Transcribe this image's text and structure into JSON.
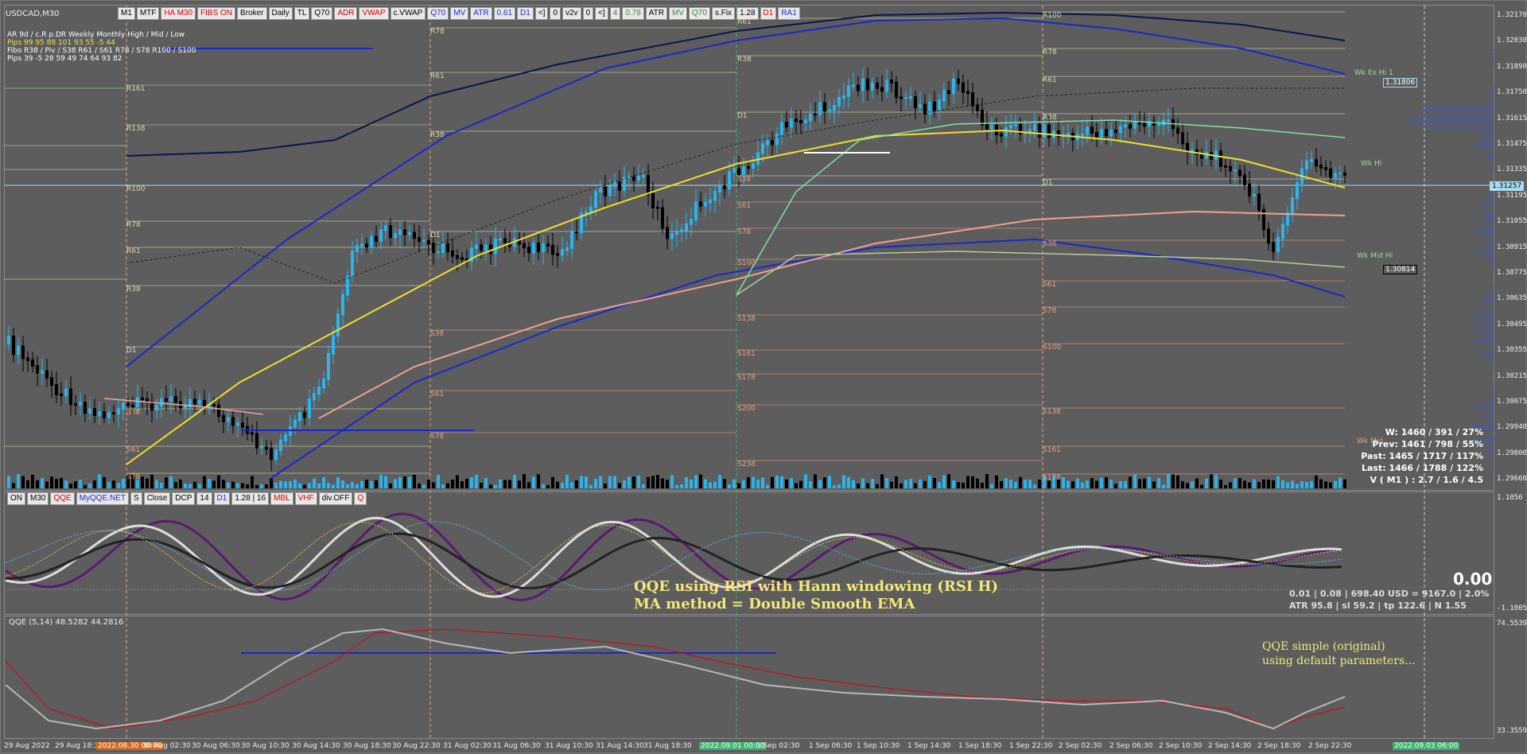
{
  "symbol": "USDCAD,M30",
  "toolbar": [
    "M1",
    "MTF",
    "HA M30",
    "FIBS ON",
    "Broker",
    "Daily",
    "TL",
    "Q70",
    "ADR",
    "VWAP",
    "c.VWAP",
    "Q70",
    "MV",
    "ATR",
    "0.61",
    "D1",
    "<]",
    "0",
    "v2v",
    "0",
    "<]",
    "4",
    "0.78",
    "ATR",
    "MV",
    "Q70",
    "s.Fix",
    "1.28",
    "D1",
    "RA1"
  ],
  "stats": {
    "row1": [
      "AR",
      "9d / c.R",
      "p.DR",
      "Weekly",
      "Monthly",
      "High / Mid / Low"
    ],
    "row2": [
      "Pips",
      "99",
      "95",
      "88",
      "101",
      "93",
      "55",
      "-5",
      "44"
    ],
    "row3": [
      "Fibo",
      "R38 / Piv / S38",
      "R61 / S61",
      "R78 / S78",
      "R100 / S100"
    ],
    "row4": [
      "Pips",
      "39",
      "-5",
      "28",
      "59",
      "49",
      "74",
      "64",
      "93",
      "82"
    ]
  },
  "price_scale": [
    "1.32170",
    "1.32030",
    "1.31890",
    "1.31750",
    "1.31615",
    "1.31475",
    "1.31335",
    "1.31195",
    "1.31055",
    "1.30915",
    "1.30775",
    "1.30635",
    "1.30495",
    "1.30355",
    "1.30215",
    "1.30075",
    "1.29940",
    "1.29800",
    "1.29660"
  ],
  "price_boxes": {
    "current": "1.31257",
    "wk_ex_hi": "1.31806",
    "wk_mid_hi": "1.30814"
  },
  "right_labels": {
    "wk_ex_hi": "Wk Ex Hi 1",
    "wk_hi": "Wk Hi",
    "wk_mid_hi": "Wk Mid Hi",
    "wk_mid": "Wk Mid"
  },
  "level_labels": {
    "day1": [
      "R161",
      "R138",
      "R100",
      "R78",
      "R61",
      "R38",
      "D1",
      "S38",
      "S61",
      "S78"
    ],
    "day2": [
      "R78",
      "R61",
      "R38",
      "D1",
      "S38",
      "S61",
      "S78"
    ],
    "day3": [
      "R61",
      "R38",
      "D1",
      "S38",
      "S61",
      "S78",
      "S100",
      "S138",
      "S161",
      "S178",
      "S200",
      "S238"
    ],
    "day4": [
      "R100",
      "R78",
      "R61",
      "R38",
      "D1",
      "S38",
      "S61",
      "S78",
      "S100",
      "S138",
      "S161",
      "S178"
    ]
  },
  "overlay_stats": [
    "W: 1460 / 391 / 27%",
    "Prev: 1461 / 798 / 55%",
    "Past: 1465 / 1717 / 117%",
    "Last: 1466 / 1788 / 122%",
    "V ( M1 ) : 2.7 / 1.6 / 4.5"
  ],
  "qqe_toolbar": [
    "ON",
    "M30",
    "QQE",
    "MyQQE.NET",
    "S",
    "Close",
    "DCP",
    "14",
    "D1",
    "1.28 | 16",
    "MBL",
    "VHF",
    "div.OFF",
    "Q"
  ],
  "qqe_scale": [
    "1.1056",
    "-1.1005"
  ],
  "qqe_value": "0.00",
  "qqe_info": [
    "0.01 | 0.08 | 698.40 USD = 9167.0 | 2.0%",
    "ATR 95.8 | sl 59.2 | tp 122.6 | N 1.55"
  ],
  "qqe_title": [
    "QQE using RSI with Hann windowing (RSI H)",
    "MA method = Double Smooth EMA"
  ],
  "qqe2_label": "QQE (5,14) 48.5282 44.2816",
  "qqe2_scale": [
    "74.5539",
    "33.3559"
  ],
  "qqe2_title": [
    "QQE simple (original)",
    "using default parameters..."
  ],
  "time_axis": [
    "29 Aug 2022",
    "29 Aug 18:30",
    "2022.08.30 00:00",
    "30 Aug 02:30",
    "30 Aug 06:30",
    "30 Aug 10:30",
    "30 Aug 14:30",
    "30 Aug 18:30",
    "30 Aug 22:30",
    "31 Aug 02:30",
    "31 Aug 06:30",
    "31 Aug 10:30",
    "31 Aug 14:30",
    "31 Aug 18:30",
    "2022.09.01 00:00",
    "1 Sep 02:30",
    "1 Sep 06:30",
    "1 Sep 10:30",
    "1 Sep 14:30",
    "1 Sep 18:30",
    "1 Sep 22:30",
    "2 Sep 02:30",
    "2 Sep 06:30",
    "2 Sep 10:30",
    "2 Sep 14:30",
    "2 Sep 18:30",
    "2 Sep 22:30",
    "2022.09.03 06:00"
  ]
}
